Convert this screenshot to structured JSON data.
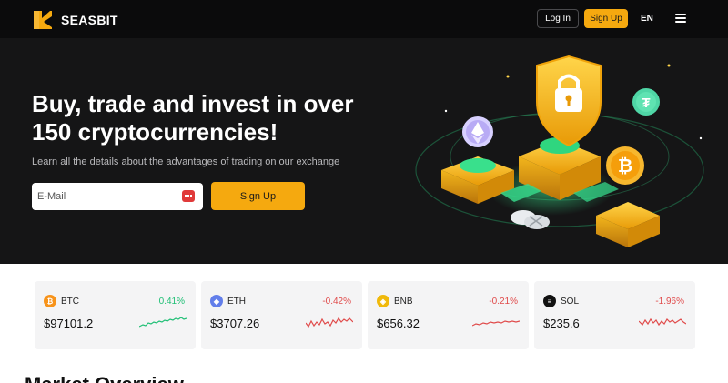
{
  "header": {
    "brand": "SEASBIT",
    "login_label": "Log In",
    "signup_label": "Sign Up",
    "language": "EN",
    "logo_color": "#f5a90f"
  },
  "hero": {
    "title_line1": "Buy, trade and invest in over",
    "title_line2": "150 cryptocurrencies!",
    "subtitle": "Learn all the details about the advantages of trading on our exchange",
    "email_placeholder": "E-Mail",
    "signup_label": "Sign Up"
  },
  "tickers": [
    {
      "symbol": "BTC",
      "change": "0.41%",
      "price": "$97101.2",
      "trend": "up",
      "icon": "bitcoin-icon",
      "icon_color": "#f7931a",
      "glyph": "₿"
    },
    {
      "symbol": "ETH",
      "change": "-0.42%",
      "price": "$3707.26",
      "trend": "down",
      "icon": "ethereum-icon",
      "icon_color": "#627eea",
      "glyph": "◆"
    },
    {
      "symbol": "BNB",
      "change": "-0.21%",
      "price": "$656.32",
      "trend": "down",
      "icon": "bnb-icon",
      "icon_color": "#f0b90b",
      "glyph": "◈"
    },
    {
      "symbol": "SOL",
      "change": "-1.96%",
      "price": "$235.6",
      "trend": "down",
      "icon": "solana-icon",
      "icon_color": "#111111",
      "glyph": "≡"
    }
  ],
  "colors": {
    "accent": "#f5a90f",
    "up": "#1fbf75",
    "down": "#e04b4b"
  },
  "market": {
    "title": "Market Overview"
  }
}
